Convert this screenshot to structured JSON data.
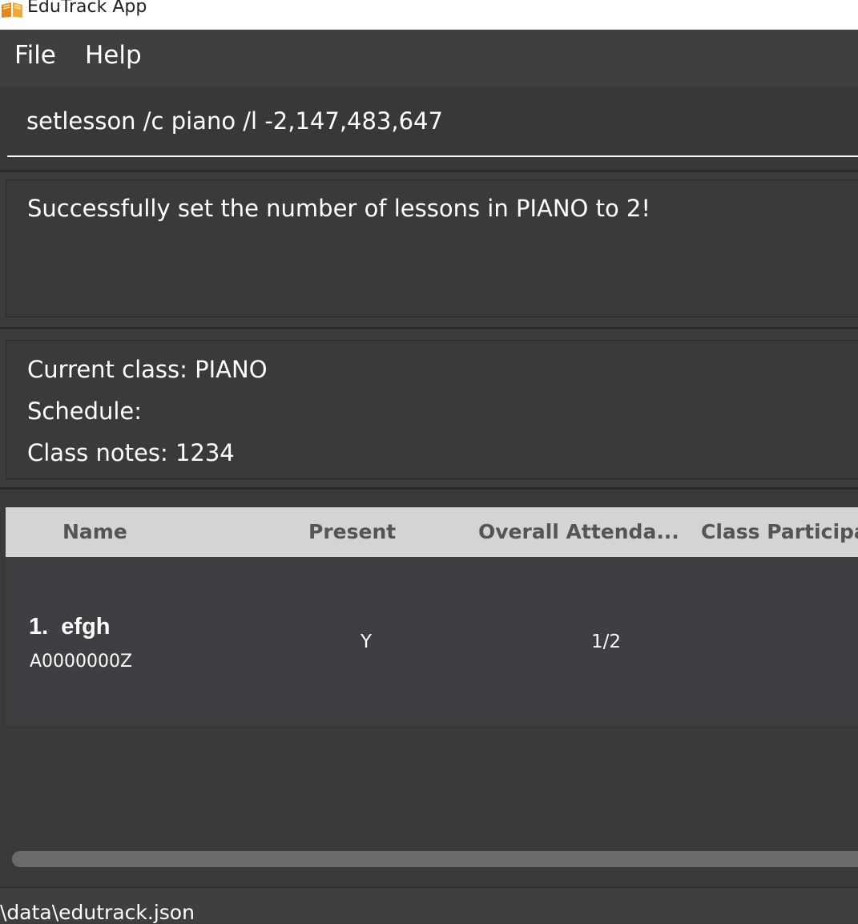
{
  "window": {
    "title": "EduTrack App",
    "icon": "book-icon"
  },
  "menu": {
    "items": [
      {
        "label": "File"
      },
      {
        "label": "Help"
      }
    ]
  },
  "command": {
    "value": "setlesson /c piano /l -2,147,483,647"
  },
  "result": {
    "message": "Successfully set the number of lessons in PIANO to 2!"
  },
  "class_info": {
    "current_class": "Current class: PIANO",
    "schedule": "Schedule:",
    "notes": "Class notes: 1234"
  },
  "table": {
    "headers": [
      "Name",
      "Present",
      "Overall Attenda...",
      "Class Participat"
    ],
    "rows": [
      {
        "index_name": "1.  efgh",
        "id": "A0000000Z",
        "present": "Y",
        "attendance": "1/2"
      }
    ]
  },
  "status": {
    "path": "\\data\\edutrack.json"
  },
  "colors": {
    "background": "#3b3b3b",
    "header_bg": "#d4d4d4",
    "row_bg": "#3e3f43"
  }
}
